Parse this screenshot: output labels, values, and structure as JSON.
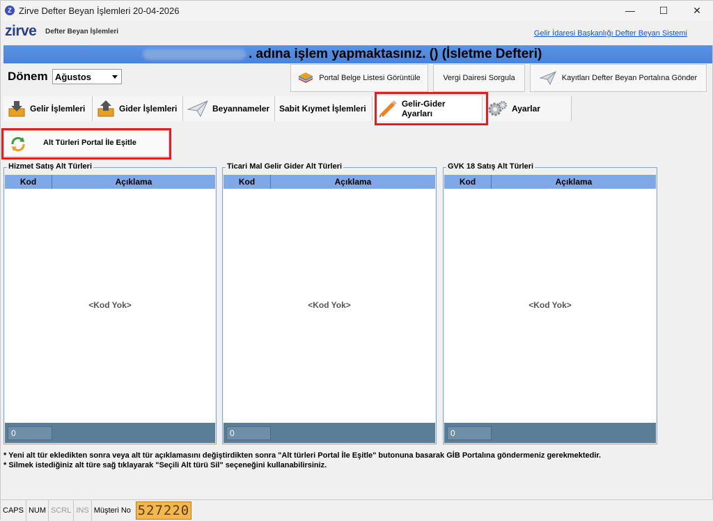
{
  "window": {
    "app_icon": "Z",
    "title": "Zirve Defter Beyan İşlemleri 20-04-2026",
    "controls": [
      "—",
      "☐",
      "✕"
    ]
  },
  "brand": {
    "logo": "zirve",
    "subtitle": "Defter Beyan İşlemleri",
    "link": "Gelir İdaresi Başkanlığı Defter Beyan Sistemi"
  },
  "banner": {
    "text": ". adına işlem yapmaktasınız. () (İsletme Defteri)"
  },
  "period": {
    "label": "Dönem",
    "selected": "Ağustos"
  },
  "top_buttons": {
    "portal_belge": "Portal Belge Listesi Görüntüle",
    "vergi_dairesi": "Vergi Dairesi Sorgula",
    "kayitlari_gonder": "Kayıtları Defter Beyan Portalına Gönder"
  },
  "tabs": [
    {
      "label": "Gelir İşlemleri",
      "icon": "inbox-down-icon"
    },
    {
      "label": "Gider İşlemleri",
      "icon": "inbox-up-icon"
    },
    {
      "label": "Beyannameler",
      "icon": "paper-plane-icon"
    },
    {
      "label": "Sabit Kıymet İşlemleri",
      "icon": ""
    },
    {
      "label": "Gelir-Gider Ayarları",
      "icon": "pencil-icon",
      "active": true
    },
    {
      "label": "Ayarlar",
      "icon": "gear-icon"
    }
  ],
  "sync_button": {
    "label": "Alt Türleri Portal İle Eşitle"
  },
  "panels": [
    {
      "title": "Hizmet Satış Alt Türleri",
      "col_kod": "Kod",
      "col_aciklama": "Açıklama",
      "empty": "<Kod Yok>",
      "count": "0"
    },
    {
      "title": "Ticari Mal Gelir Gider Alt Türleri",
      "col_kod": "Kod",
      "col_aciklama": "Açıklama",
      "empty": "<Kod Yok>",
      "count": "0"
    },
    {
      "title": "GVK 18 Satış Alt Türleri",
      "col_kod": "Kod",
      "col_aciklama": "Açıklama",
      "empty": "<Kod Yok>",
      "count": "0"
    }
  ],
  "notes": [
    "* Yeni alt tür ekledikten sonra veya alt tür açıklamasını değiştirdikten sonra \"Alt türleri Portal İle Eşitle\" butonuna basarak GİB Portalına göndermeniz gerekmektedir.",
    "* Silmek istediğiniz alt türe sağ tıklayarak \"Seçili Alt türü Sil\" seçeneğini kullanabilirsiniz."
  ],
  "statusbar": {
    "caps": "CAPS",
    "num": "NUM",
    "scrl": "SCRL",
    "ins": "INS",
    "musteri_label": "Müşteri No",
    "musteri_no": "527220"
  },
  "colors": {
    "banner": "#5b93e2",
    "grid_header": "#7fa8e8",
    "grid_footer": "#5b7e98",
    "highlight": "#e02020",
    "link": "#1a4fd8"
  }
}
